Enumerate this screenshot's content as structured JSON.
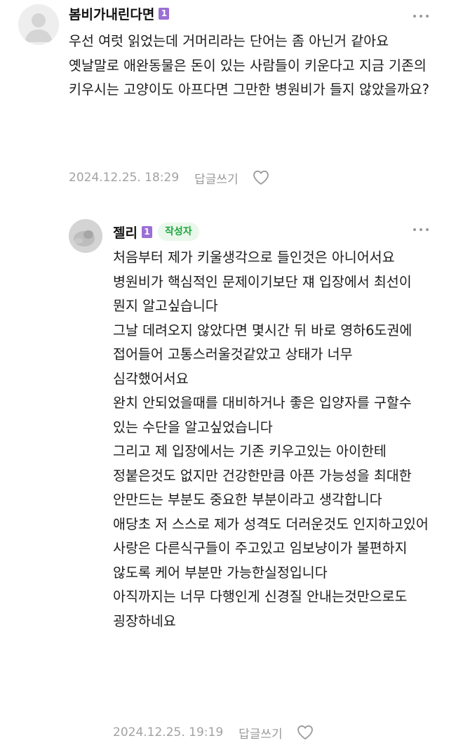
{
  "comments": [
    {
      "nickname": "봄비가내린다면",
      "level": "1",
      "is_author": false,
      "text": "우선 여럿 읽었는데 거머리라는 단어는 좀 아닌거 같아요\n옛날말로 애완동물은 돈이 있는 사람들이 키운다고 지금 기존의 키우시는 고양이도 아프다면 그만한 병원비가 들지 않았을까요?",
      "timestamp": "2024.12.25. 18:29",
      "reply_label": "답글쓰기",
      "icons": {
        "avatar": "default-avatar",
        "more": "more-dots-icon",
        "like": "heart-outline-icon"
      }
    },
    {
      "nickname": "젤리",
      "level": "1",
      "author_badge": "작성자",
      "is_author": true,
      "text": "처음부터 제가 키울생각으로 들인것은 아니어서요 병원비가 핵심적인 문제이기보단 쟤 입장에서 최선이 뭔지 알고싶습니다\n그날 데려오지 않았다면 몇시간 뒤 바로 영하6도권에 접어들어 고통스러울것같았고 상태가 너무 심각했어서요\n완치 안되었을때를 대비하거나 좋은 입양자를 구할수 있는 수단을 알고싶었습니다\n그리고 제 입장에서는 기존 키우고있는 아이한테 정붙은것도 없지만 건강한만큼 아픈 가능성을 최대한 안만드는 부분도 중요한 부분이라고 생각합니다\n애당초 저 스스로 제가 성격도 더러운것도 인지하고있어 사랑은 다른식구들이 주고있고 임보냥이가 불편하지 않도록 케어 부분만 가능한실정입니다\n아직까지는 너무 다행인게 신경질 안내는것만으로도 굉장하네요",
      "timestamp": "2024.12.25. 19:19",
      "reply_label": "답글쓰기",
      "icons": {
        "avatar": "user-photo-avatar",
        "more": "more-dots-icon",
        "like": "heart-outline-icon"
      }
    }
  ],
  "colors": {
    "level_badge": "#9b6fd6",
    "author_badge_bg": "#eaf8ec",
    "author_badge_text": "#1ea83c",
    "meta_text": "#a2a2a2"
  }
}
